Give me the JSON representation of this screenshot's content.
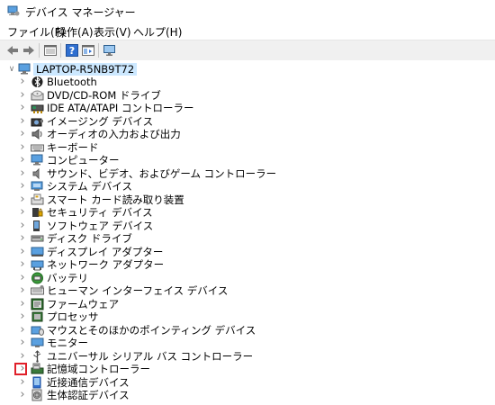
{
  "window": {
    "title": "デバイス マネージャー"
  },
  "menu": [
    {
      "label": "ファイル(F)"
    },
    {
      "label": "操作(A)"
    },
    {
      "label": "表示(V)"
    },
    {
      "label": "ヘルプ(H)"
    }
  ],
  "toolbar": [
    {
      "icon": "back-arrow-icon"
    },
    {
      "icon": "forward-arrow-icon"
    },
    {
      "icon": "properties-icon"
    },
    {
      "icon": "help-icon"
    },
    {
      "icon": "show-hide-console-tree-icon"
    },
    {
      "icon": "scan-hardware-icon"
    }
  ],
  "tree": {
    "root": {
      "label": "LAPTOP-R5NB9T72",
      "icon": "computer-icon"
    },
    "items": [
      {
        "label": "Bluetooth",
        "icon": "bluetooth-icon"
      },
      {
        "label": "DVD/CD-ROM ドライブ",
        "icon": "dvd-drive-icon"
      },
      {
        "label": "IDE ATA/ATAPI コントローラー",
        "icon": "ide-controller-icon"
      },
      {
        "label": "イメージング デバイス",
        "icon": "camera-icon"
      },
      {
        "label": "オーディオの入力および出力",
        "icon": "speaker-icon"
      },
      {
        "label": "キーボード",
        "icon": "keyboard-icon"
      },
      {
        "label": "コンピューター",
        "icon": "computer-icon"
      },
      {
        "label": "サウンド、ビデオ、およびゲーム コントローラー",
        "icon": "sound-icon"
      },
      {
        "label": "システム デバイス",
        "icon": "system-device-icon"
      },
      {
        "label": "スマート カード読み取り装置",
        "icon": "smart-card-reader-icon"
      },
      {
        "label": "セキュリティ デバイス",
        "icon": "security-device-icon"
      },
      {
        "label": "ソフトウェア デバイス",
        "icon": "software-device-icon"
      },
      {
        "label": "ディスク ドライブ",
        "icon": "disk-drive-icon"
      },
      {
        "label": "ディスプレイ アダプター",
        "icon": "display-adapter-icon"
      },
      {
        "label": "ネットワーク アダプター",
        "icon": "network-adapter-icon"
      },
      {
        "label": "バッテリ",
        "icon": "battery-icon"
      },
      {
        "label": "ヒューマン インターフェイス デバイス",
        "icon": "hid-icon"
      },
      {
        "label": "ファームウェア",
        "icon": "firmware-icon"
      },
      {
        "label": "プロセッサ",
        "icon": "processor-icon"
      },
      {
        "label": "マウスとそのほかのポインティング デバイス",
        "icon": "mouse-icon"
      },
      {
        "label": "モニター",
        "icon": "monitor-icon"
      },
      {
        "label": "ユニバーサル シリアル バス コントローラー",
        "icon": "usb-icon"
      },
      {
        "label": "記憶域コントローラー",
        "icon": "storage-controller-icon",
        "highlighted": true
      },
      {
        "label": "近接通信デバイス",
        "icon": "proximity-device-icon"
      },
      {
        "label": "生体認証デバイス",
        "icon": "biometric-device-icon"
      }
    ]
  }
}
